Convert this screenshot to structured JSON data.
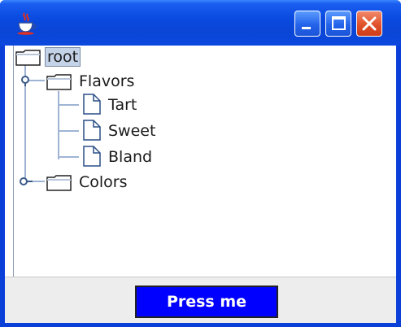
{
  "window": {
    "title": "",
    "controls": [
      "minimize",
      "maximize",
      "close"
    ]
  },
  "tree": {
    "root": {
      "label": "root",
      "icon": "folder-icon",
      "selected": true
    },
    "nodes": [
      {
        "label": "Flavors",
        "icon": "folder-icon",
        "expanded": true,
        "children": [
          {
            "label": "Tart",
            "icon": "file-icon"
          },
          {
            "label": "Sweet",
            "icon": "file-icon"
          },
          {
            "label": "Bland",
            "icon": "file-icon"
          }
        ]
      },
      {
        "label": "Colors",
        "icon": "folder-icon",
        "expanded": false,
        "children": []
      }
    ]
  },
  "button": {
    "label": "Press me"
  },
  "colors": {
    "titlebar": "#0a45d6",
    "button_bg": "#0000ff",
    "button_text": "#ffffff",
    "close_button": "#e0512a"
  }
}
